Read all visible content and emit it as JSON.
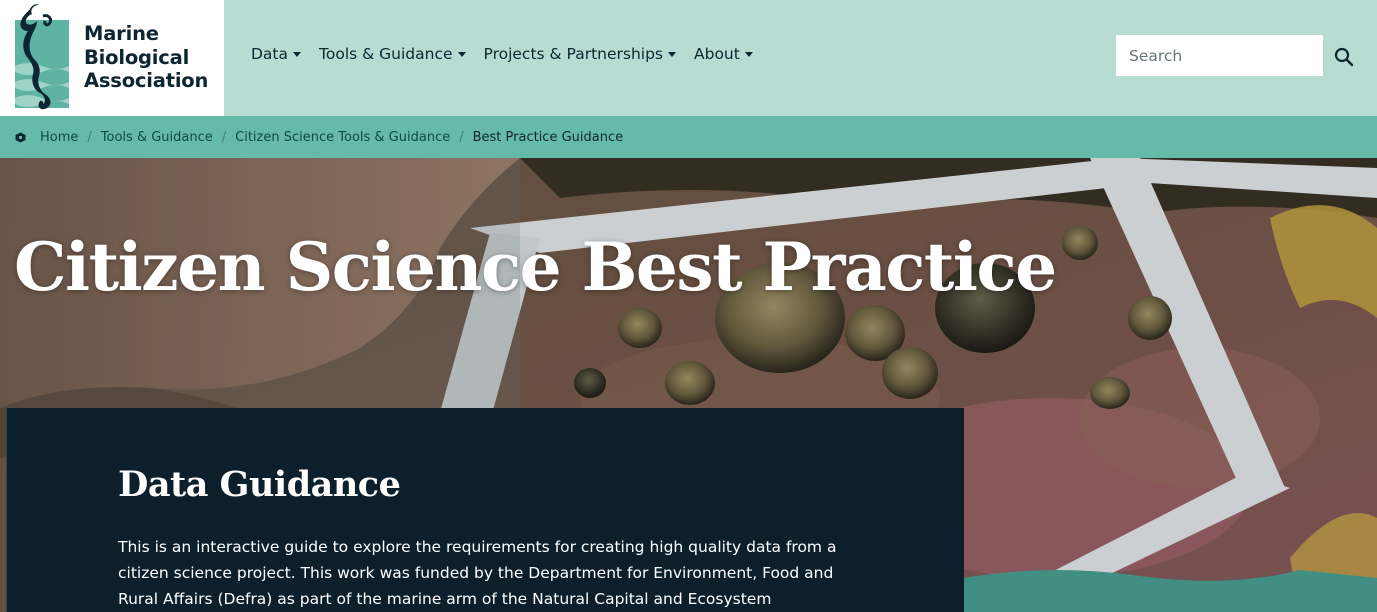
{
  "brand": {
    "name_lines": [
      "Marine",
      "Biological",
      "Association"
    ],
    "colors": {
      "dark": "#0d2631",
      "teal": "#5fb3a2",
      "mint": "#b7ddd3",
      "breadcrumb": "#66baa9",
      "panel": "#0c1f2b"
    }
  },
  "nav": {
    "items": [
      {
        "label": "Data",
        "icon": "caret-down-icon"
      },
      {
        "label": "Tools & Guidance",
        "icon": "caret-down-icon"
      },
      {
        "label": "Projects & Partnerships",
        "icon": "caret-down-icon"
      },
      {
        "label": "About",
        "icon": "caret-down-icon"
      }
    ]
  },
  "search": {
    "placeholder": "Search",
    "value": "",
    "icon": "magnifier-icon"
  },
  "breadcrumb": {
    "home_icon": "home-icon",
    "links": [
      "Home",
      "Tools & Guidance",
      "Citizen Science Tools & Guidance"
    ],
    "current": "Best Practice Guidance",
    "separator": "/"
  },
  "hero": {
    "title": "Citizen Science Best Practice",
    "image": "photo of a hand placing a white survey quadrat over rocky shore with limpets and seaweed"
  },
  "panel": {
    "title": "Data Guidance",
    "body": "This is an interactive guide to explore the requirements for creating high quality data from a citizen science project. This work was funded by the Department for Environment, Food and Rural Affairs (Defra) as part of the marine arm of the Natural Capital and Ecosystem"
  }
}
